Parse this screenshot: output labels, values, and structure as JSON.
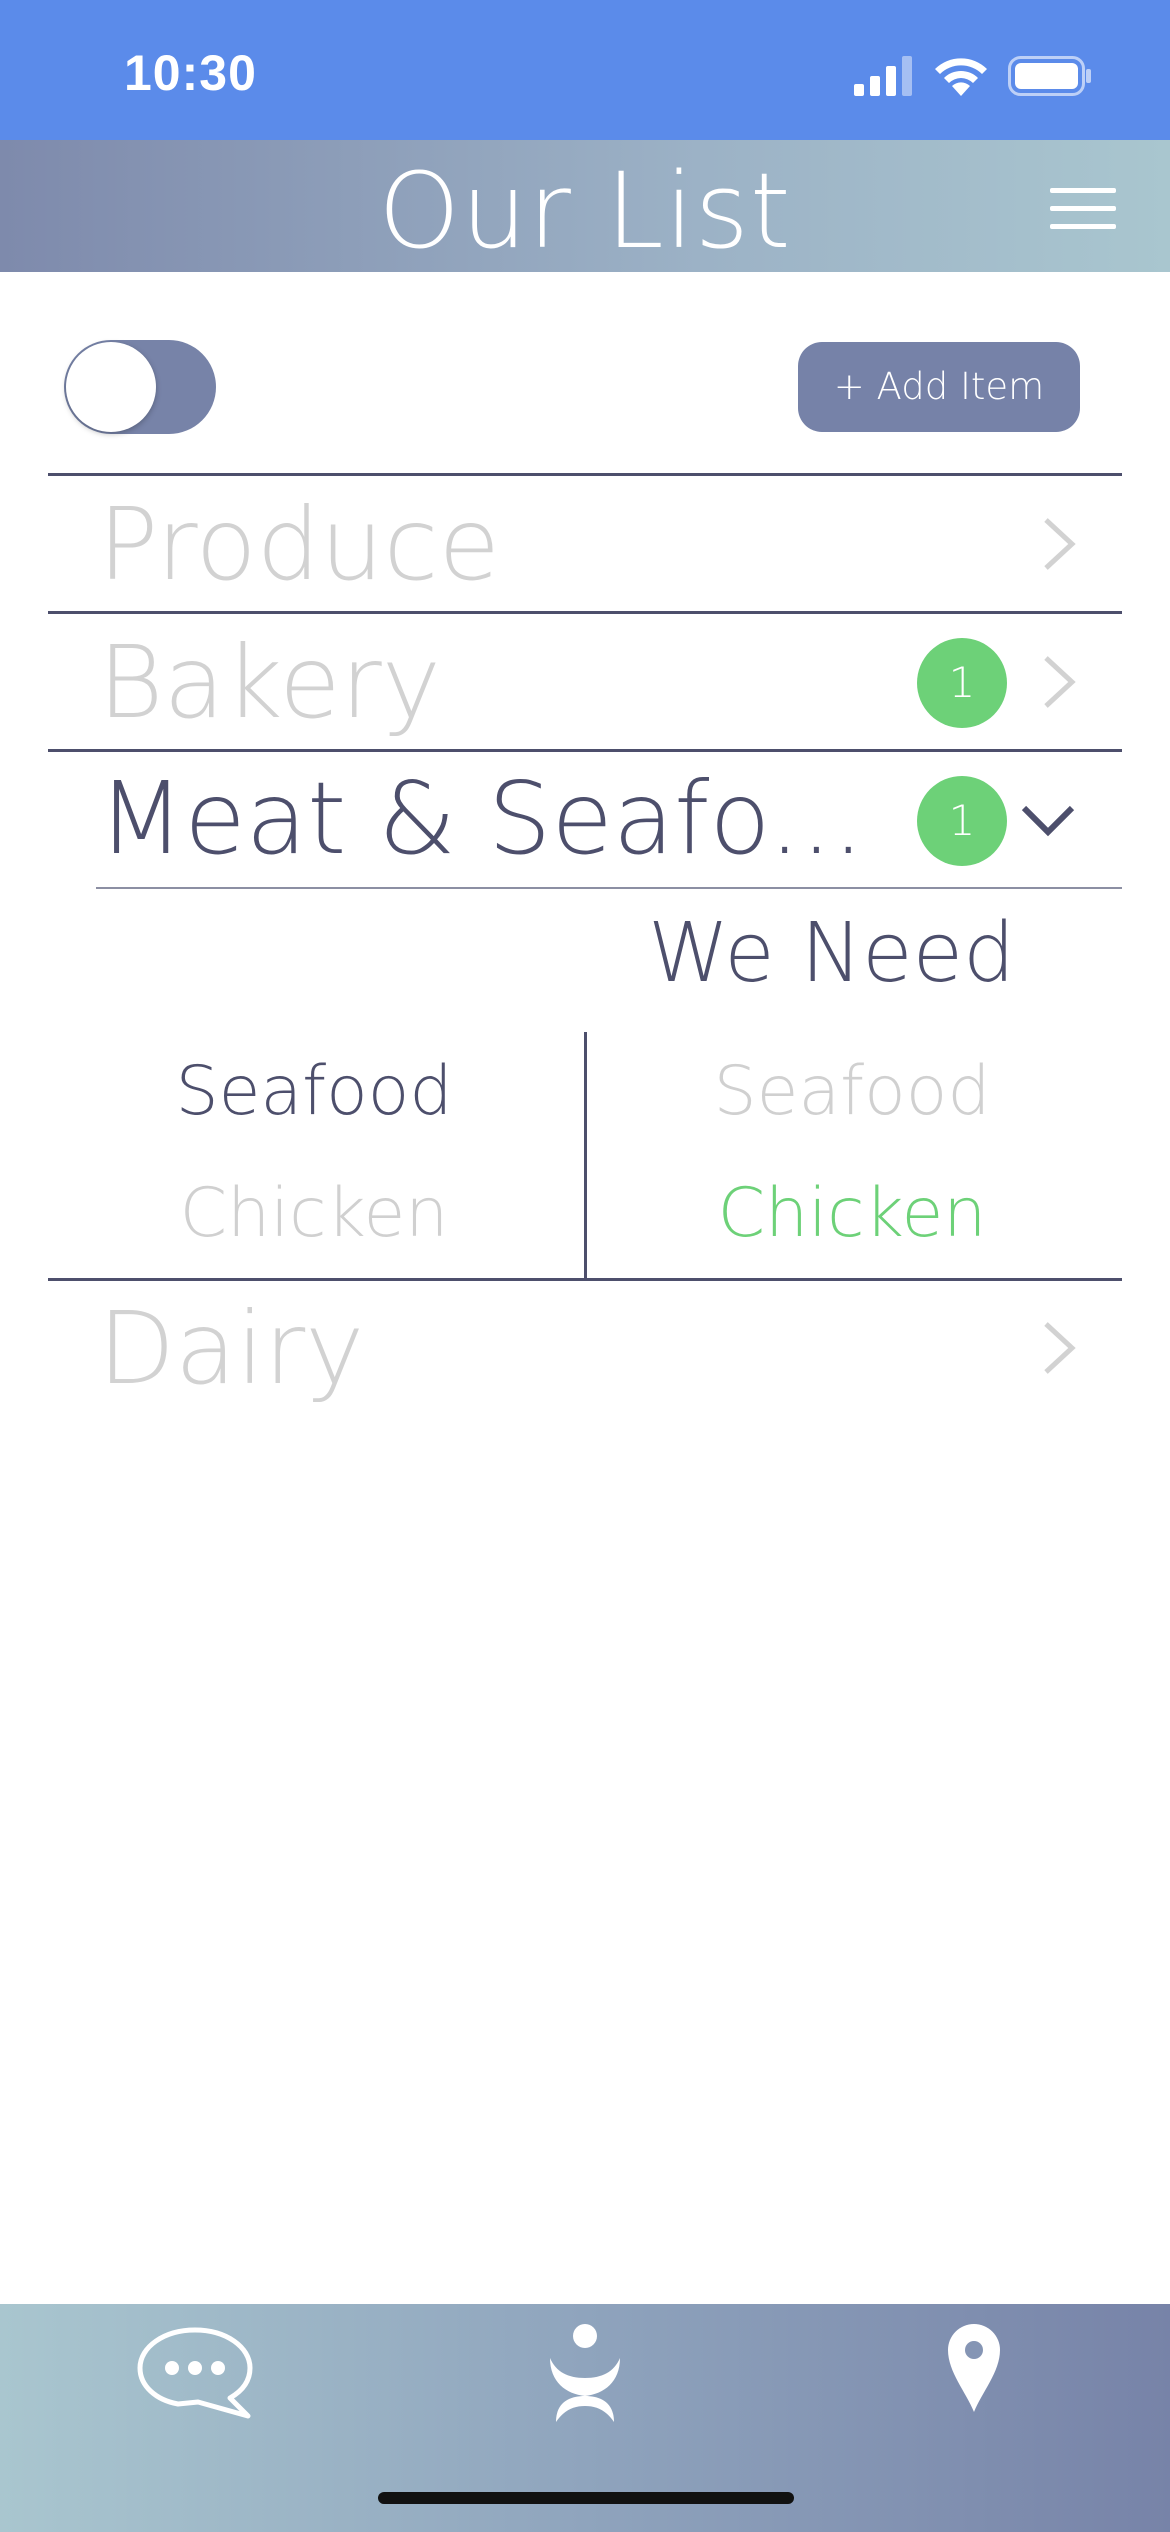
{
  "status_bar": {
    "time": "10:30"
  },
  "header": {
    "title": "Our List"
  },
  "controls": {
    "add_item_label": "+ Add Item"
  },
  "categories": [
    {
      "label": "Produce",
      "badge": null,
      "expanded": false
    },
    {
      "label": "Bakery",
      "badge": "1",
      "expanded": false
    },
    {
      "label": "Meat & Seafo...",
      "badge": "1",
      "expanded": true
    },
    {
      "label": "Dairy",
      "badge": null,
      "expanded": false
    }
  ],
  "expanded_section": {
    "column_header": "We Need",
    "left_items": [
      "Seafood",
      "Chicken"
    ],
    "right_items": [
      "Seafood",
      "Chicken"
    ]
  },
  "colors": {
    "status_bar": "#5b8bea",
    "accent": "#7682a8",
    "text_dark": "#4d4f6c",
    "text_inactive": "#d2d2d2",
    "badge_green": "#6dd178"
  },
  "tab_bar": {
    "icons": [
      "chat-bubble-icon",
      "app-logo-icon",
      "location-pin-icon"
    ]
  }
}
